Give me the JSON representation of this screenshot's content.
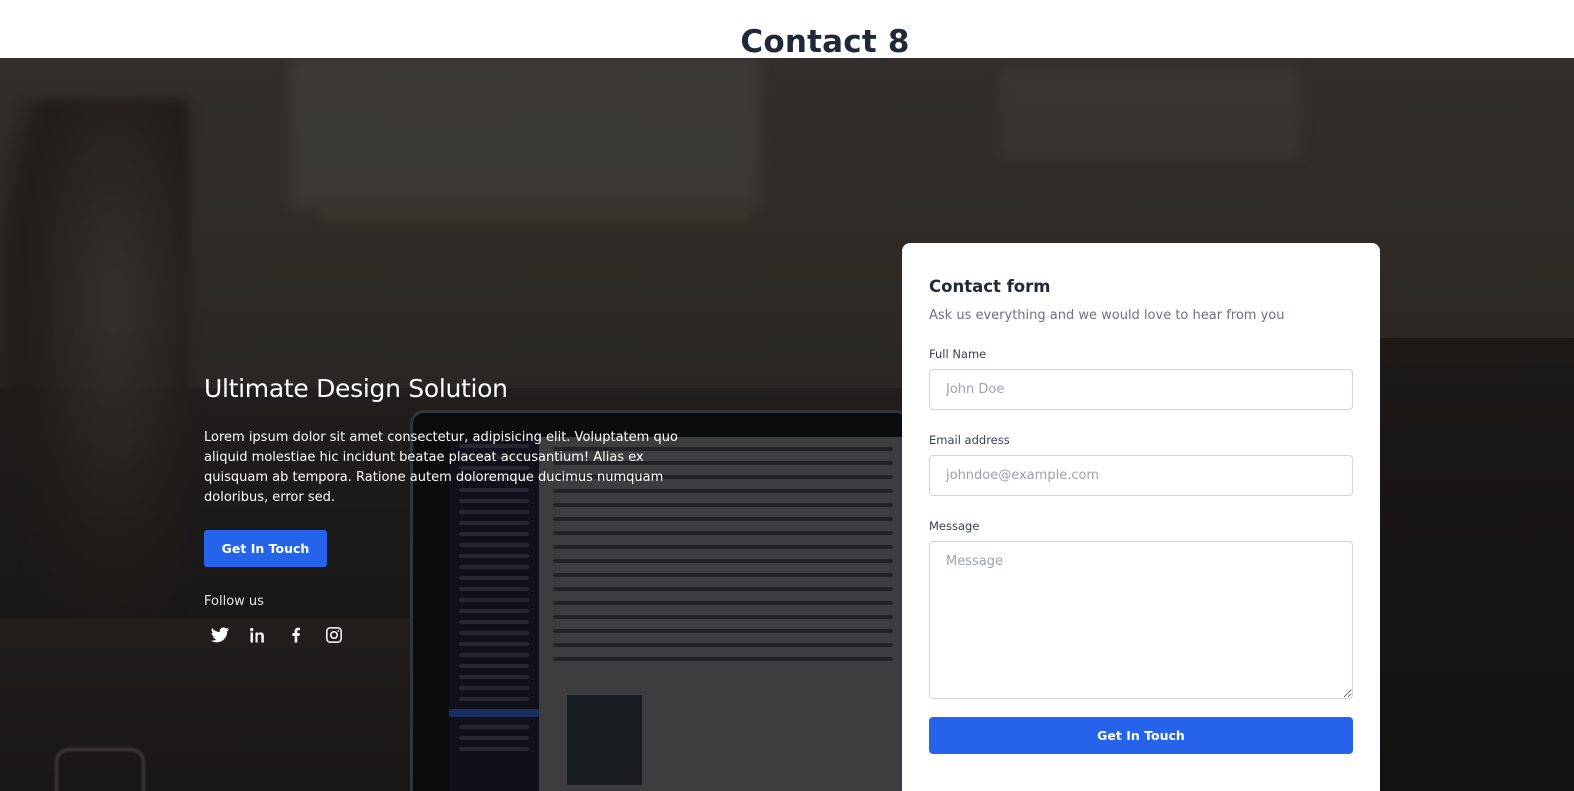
{
  "page": {
    "title": "Contact 8"
  },
  "intro": {
    "title": "Ultimate Design Solution",
    "text": "Lorem ipsum dolor sit amet consectetur, adipisicing elit. Voluptatem quo aliquid molestiae hic incidunt beatae placeat accusantium! Alias ex quisquam ab tempora. Ratione autem doloremque ducimus numquam doloribus, error sed.",
    "button_label": "Get In Touch",
    "follow_label": "Follow us",
    "social": [
      "twitter-icon",
      "linkedin-icon",
      "facebook-icon",
      "instagram-icon"
    ]
  },
  "form": {
    "title": "Contact form",
    "subtitle": "Ask us everything and we would love to hear from you",
    "full_name": {
      "label": "Full Name",
      "placeholder": "John Doe",
      "value": ""
    },
    "email": {
      "label": "Email address",
      "placeholder": "johndoe@example.com",
      "value": ""
    },
    "message": {
      "label": "Message",
      "placeholder": "Message",
      "value": ""
    },
    "submit_label": "Get In Touch"
  },
  "colors": {
    "accent": "#2563eb",
    "heading": "#1f2937",
    "muted": "#6b7280"
  }
}
